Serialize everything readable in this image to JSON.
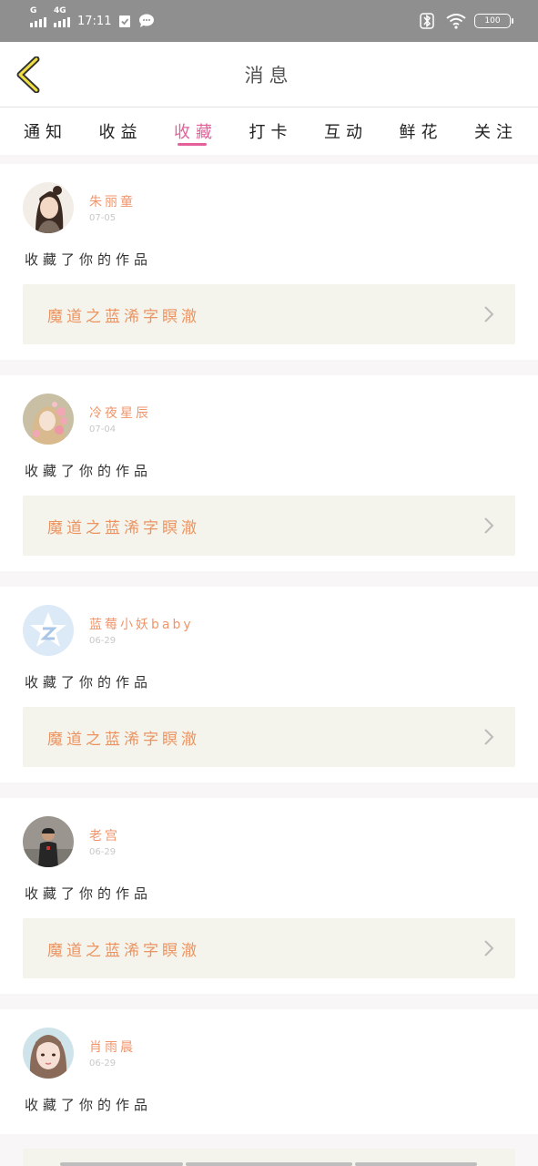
{
  "status_bar": {
    "network_1": "G",
    "network_2": "4G",
    "time": "17:11",
    "battery": "100"
  },
  "header": {
    "title": "消息"
  },
  "tabs": [
    {
      "label": "通知"
    },
    {
      "label": "收益"
    },
    {
      "label": "收藏"
    },
    {
      "label": "打卡"
    },
    {
      "label": "互动"
    },
    {
      "label": "鲜花"
    },
    {
      "label": "关注"
    }
  ],
  "active_tab": "收藏",
  "messages": [
    {
      "user": "朱丽童",
      "date": "07-05",
      "action": "收藏了你的作品",
      "work_title": "魔道之蓝浠字瞑澈",
      "avatar_icon": "girl-hanfu-avatar"
    },
    {
      "user": "冷夜星辰",
      "date": "07-04",
      "action": "收藏了你的作品",
      "work_title": "魔道之蓝浠字瞑澈",
      "avatar_icon": "flower-girl-avatar"
    },
    {
      "user": "蓝莓小妖baby",
      "date": "06-29",
      "action": "收藏了你的作品",
      "work_title": "魔道之蓝浠字瞑澈",
      "avatar_icon": "default-star-avatar"
    },
    {
      "user": "老宫",
      "date": "06-29",
      "action": "收藏了你的作品",
      "work_title": "魔道之蓝浠字瞑澈",
      "avatar_icon": "man-photo-avatar"
    },
    {
      "user": "肖雨晨",
      "date": "06-29",
      "action": "收藏了你的作品",
      "work_title": "",
      "avatar_icon": "girl-photo-avatar"
    }
  ],
  "colors": {
    "accent": "#e4609b",
    "username": "#f0956b",
    "work_title": "#eb9461",
    "work_bg": "#f4f4ec",
    "status_bar": "#8f8f8f"
  }
}
